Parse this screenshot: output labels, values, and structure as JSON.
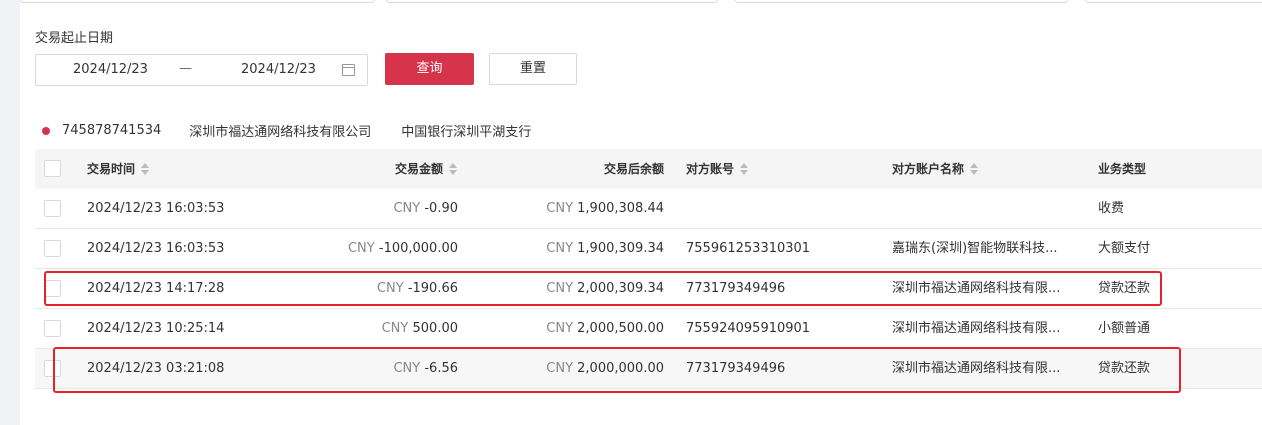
{
  "filters": {
    "date_label": "交易起止日期",
    "start_date": "2024/12/23",
    "separator": "—",
    "end_date": "2024/12/23",
    "query_label": "查询",
    "reset_label": "重置"
  },
  "account": {
    "number": "745878741534",
    "name": "深圳市福达通网络科技有限公司",
    "bank": "中国银行深圳平湖支行"
  },
  "table": {
    "headers": {
      "time": "交易时间",
      "amount": "交易金额",
      "balance": "交易后余额",
      "counter_account": "对方账号",
      "counter_name": "对方账户名称",
      "biz_type": "业务类型"
    },
    "currency": "CNY",
    "rows": [
      {
        "time": "2024/12/23 16:03:53",
        "amount": "-0.90",
        "balance": "1,900,308.44",
        "counter_account": "",
        "counter_name": "",
        "biz_type": "收费"
      },
      {
        "time": "2024/12/23 16:03:53",
        "amount": "-100,000.00",
        "balance": "1,900,309.34",
        "counter_account": "755961253310301",
        "counter_name": "嘉瑞东(深圳)智能物联科技...",
        "biz_type": "大额支付"
      },
      {
        "time": "2024/12/23 14:17:28",
        "amount": "-190.66",
        "balance": "2,000,309.34",
        "counter_account": "773179349496",
        "counter_name": "深圳市福达通网络科技有限...",
        "biz_type": "贷款还款"
      },
      {
        "time": "2024/12/23 10:25:14",
        "amount": "500.00",
        "balance": "2,000,500.00",
        "counter_account": "755924095910901",
        "counter_name": "深圳市福达通网络科技有限...",
        "biz_type": "小额普通"
      },
      {
        "time": "2024/12/23 03:21:08",
        "amount": "-6.56",
        "balance": "2,000,000.00",
        "counter_account": "773179349496",
        "counter_name": "深圳市福达通网络科技有限...",
        "biz_type": "贷款还款"
      }
    ]
  },
  "colors": {
    "accent": "#d6344a",
    "highlight": "#e8222a"
  }
}
